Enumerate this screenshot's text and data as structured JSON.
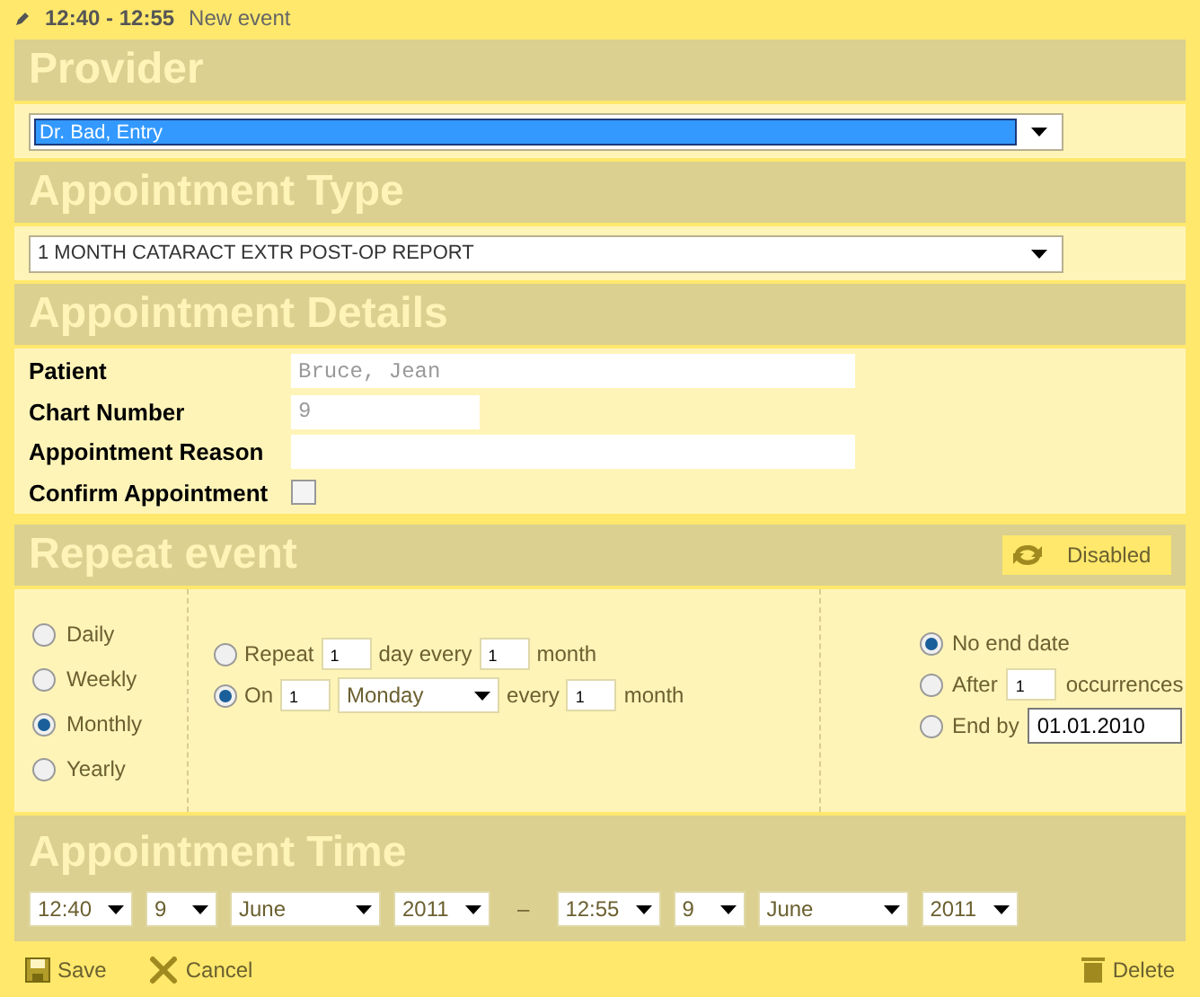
{
  "title_bar": {
    "time": "12:40 - 12:55",
    "title": "New event"
  },
  "provider": {
    "heading": "Provider",
    "value": "Dr. Bad, Entry",
    "highlighted": true
  },
  "appointment_type": {
    "heading": "Appointment Type",
    "value": "1 MONTH CATARACT EXTR POST-OP REPORT",
    "highlighted": false
  },
  "details": {
    "heading": "Appointment Details",
    "fields": [
      {
        "label": "Patient",
        "kind": "long",
        "value": "Bruce, Jean"
      },
      {
        "label": "Chart Number",
        "kind": "short",
        "value": "9"
      },
      {
        "label": "Appointment Reason",
        "kind": "long"
      },
      {
        "label": "Confirm Appointment",
        "kind": "checkbox",
        "checked": false
      }
    ]
  },
  "repeat": {
    "heading": "Repeat event",
    "toggle": "Disabled",
    "frequencies": [
      {
        "label": "Daily",
        "selected": false
      },
      {
        "label": "Weekly",
        "selected": false
      },
      {
        "label": "Monthly",
        "selected": true
      },
      {
        "label": "Yearly",
        "selected": false
      }
    ],
    "patterns": [
      {
        "selected": false,
        "parts": [
          {
            "kind": "text",
            "text": "Repeat"
          },
          {
            "kind": "input",
            "text": "1"
          },
          {
            "kind": "text",
            "text": "day every"
          },
          {
            "kind": "input",
            "text": "1"
          },
          {
            "kind": "text",
            "text": "month"
          }
        ]
      },
      {
        "selected": true,
        "parts": [
          {
            "kind": "text",
            "text": "On"
          },
          {
            "kind": "input",
            "text": "1"
          },
          {
            "kind": "select",
            "text": "Monday"
          },
          {
            "kind": "text",
            "text": "every"
          },
          {
            "kind": "input",
            "text": "1"
          },
          {
            "kind": "text",
            "text": "month"
          }
        ]
      }
    ],
    "end_options": [
      {
        "selected": true,
        "parts": [
          {
            "kind": "text",
            "text": "No end date"
          }
        ]
      },
      {
        "selected": false,
        "parts": [
          {
            "kind": "text",
            "text": "After"
          },
          {
            "kind": "input",
            "text": "1"
          },
          {
            "kind": "text",
            "text": "occurrences"
          }
        ]
      },
      {
        "selected": false,
        "parts": [
          {
            "kind": "text",
            "text": "End by"
          },
          {
            "kind": "date",
            "text": "01.01.2010"
          }
        ]
      }
    ]
  },
  "time": {
    "heading": "Appointment Time",
    "start": [
      {
        "kind": "time",
        "value": "12:40"
      },
      {
        "kind": "day",
        "value": "9"
      },
      {
        "kind": "month",
        "value": "June"
      },
      {
        "kind": "year",
        "value": "2011"
      }
    ],
    "separator": "–",
    "end": [
      {
        "kind": "time",
        "value": "12:55"
      },
      {
        "kind": "day",
        "value": "9"
      },
      {
        "kind": "month",
        "value": "June"
      },
      {
        "kind": "year",
        "value": "2011"
      }
    ]
  },
  "footer": {
    "actions": [
      {
        "kind": "save",
        "label": "Save"
      },
      {
        "kind": "cancel",
        "label": "Cancel"
      }
    ],
    "delete": "Delete"
  }
}
